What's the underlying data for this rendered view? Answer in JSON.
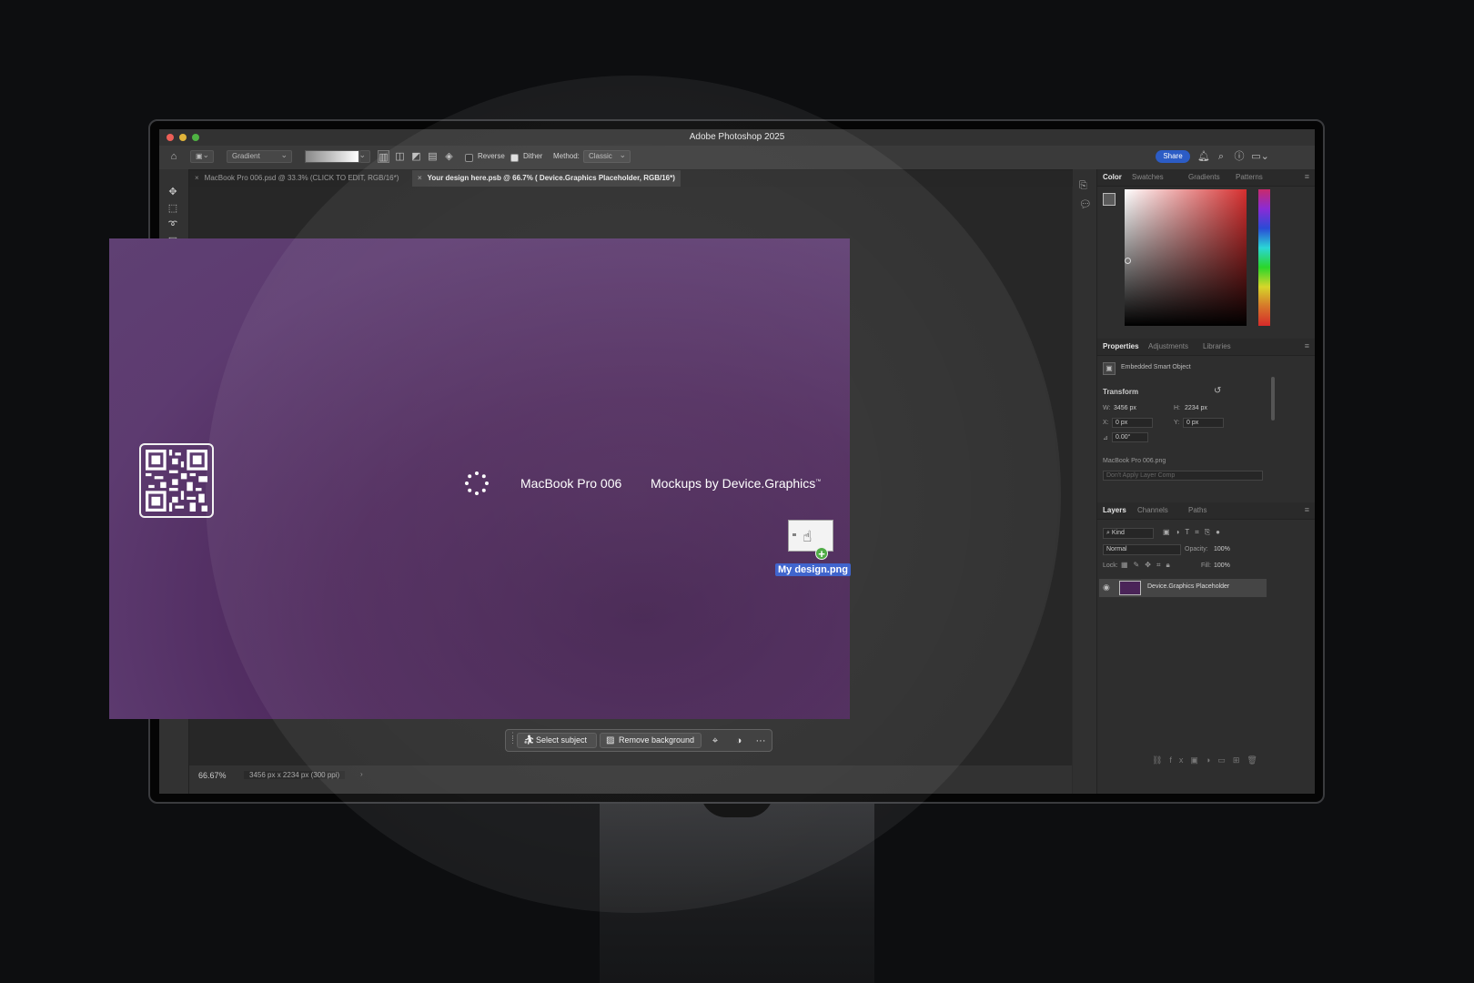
{
  "window": {
    "title": "Adobe Photoshop 2025"
  },
  "options": {
    "gradient_preset": "Gradient",
    "reverse_label": "Reverse",
    "reverse_checked": false,
    "dither_label": "Dither",
    "dither_checked": true,
    "method_label": "Method:",
    "method_value": "Classic",
    "share_label": "Share"
  },
  "tabs": [
    {
      "label": "MacBook Pro 006.psd @ 33.3% (CLICK TO EDIT, RGB/16*)",
      "active": false
    },
    {
      "label": "Your design here.psb @ 66.7% ( Device.Graphics Placeholder, RGB/16*)",
      "active": true
    }
  ],
  "canvas": {
    "brand_text": "MacBook Pro  006",
    "credit_text": "Mockups by Device.Graphics",
    "credit_mark": "™",
    "drag_file": "My design.png"
  },
  "contextual_bar": {
    "select_subject": "Select subject",
    "remove_background": "Remove background"
  },
  "status": {
    "zoom": "66.67%",
    "doc_info": "3456 px x 2234 px (300 ppi)"
  },
  "color_panel": {
    "tabs": [
      "Color",
      "Swatches",
      "Gradients",
      "Patterns"
    ]
  },
  "properties_panel": {
    "tabs": [
      "Properties",
      "Adjustments",
      "Libraries"
    ],
    "object_type": "Embedded Smart Object",
    "transform_label": "Transform",
    "w_label": "W:",
    "w_value": "3456 px",
    "h_label": "H:",
    "h_value": "2234 px",
    "x_label": "X:",
    "x_value": "0 px",
    "y_label": "Y:",
    "y_value": "0 px",
    "angle_value": "0.00°",
    "linked_file": "MacBook Pro 006.png",
    "layer_comp": "Don't Apply Layer Comp"
  },
  "layers_panel": {
    "tabs": [
      "Layers",
      "Channels",
      "Paths"
    ],
    "filter_kind": "Kind",
    "blend_mode": "Normal",
    "opacity_label": "Opacity:",
    "opacity_value": "100%",
    "lock_label": "Lock:",
    "fill_label": "Fill:",
    "fill_value": "100%",
    "layers": [
      {
        "name": "Device.Graphics Placeholder",
        "visible": true
      }
    ]
  },
  "colors": {
    "canvas_purple": "#4a2458",
    "share_blue": "#2c5cc5",
    "drag_label_blue": "#2f57c9",
    "plus_green": "#3fa535"
  }
}
